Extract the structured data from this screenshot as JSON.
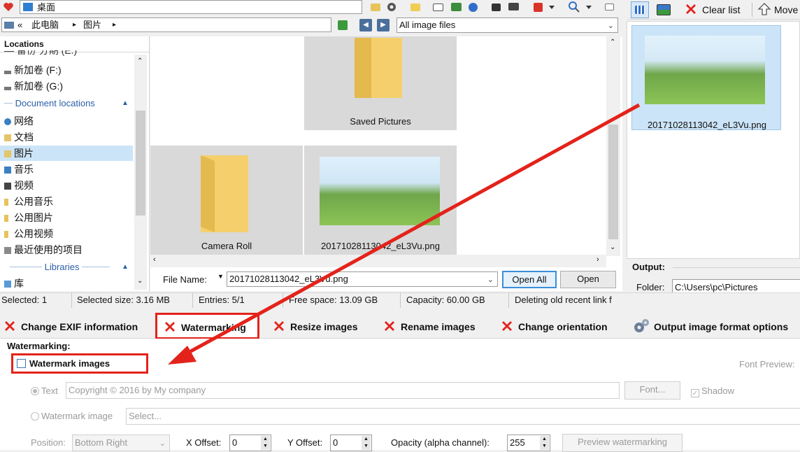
{
  "top_bar": {
    "location": "桌面"
  },
  "address": {
    "arrow": "«",
    "crumbs": [
      "此电脑",
      "图片"
    ],
    "filter": "All image files"
  },
  "right_toolbar": {
    "clear_list": "Clear list",
    "move": "Move"
  },
  "sidebar": {
    "header": "Locations",
    "items": [
      {
        "label": "新加卷 (F:)"
      },
      {
        "label": "新加卷 (G:)"
      },
      {
        "label": "Document locations"
      },
      {
        "label": "网络"
      },
      {
        "label": "文档"
      },
      {
        "label": "图片"
      },
      {
        "label": "音乐"
      },
      {
        "label": "视频"
      },
      {
        "label": "公用音乐"
      },
      {
        "label": "公用图片"
      },
      {
        "label": "公用视频"
      },
      {
        "label": "最近使用的项目"
      },
      {
        "label": "Libraries"
      },
      {
        "label": "库"
      }
    ]
  },
  "files": [
    {
      "name": "Saved Pictures"
    },
    {
      "name": "Camera Roll"
    },
    {
      "name": "20171028113042_eL3Vu.png"
    }
  ],
  "preview": {
    "name": "20171028113042_eL3Vu.png"
  },
  "filename_bar": {
    "label": "File Name:",
    "value": "20171028113042_eL3Vu.png",
    "open_all": "Open All",
    "open": "Open"
  },
  "output": {
    "title": "Output:",
    "folder_label": "Folder:",
    "folder_value": "C:\\Users\\pc\\Pictures"
  },
  "statusbar": {
    "selected": "Selected: 1",
    "size": "Selected size: 3.16 MB",
    "entries": "Entries: 5/1",
    "free": "Free space: 13.09 GB",
    "capacity": "Capacity: 60.00 GB",
    "deleting": "Deleting old recent link f"
  },
  "tabs": {
    "exif": "Change EXIF information",
    "watermarking": "Watermarking",
    "resize": "Resize images",
    "rename": "Rename images",
    "orientation": "Change orientation",
    "output_format": "Output image format options"
  },
  "watermark": {
    "section": "Watermarking:",
    "checkbox": "Watermark images",
    "font_preview": "Font Preview:",
    "text_label": "Text",
    "text_value": "Copyright © 2016 by My company",
    "font_button": "Font...",
    "shadow": "Shadow",
    "image_label": "Watermark image",
    "image_value": "Select...",
    "position_label": "Position:",
    "position_value": "Bottom Right",
    "x_label": "X Offset:",
    "x_value": "0",
    "y_label": "Y Offset:",
    "y_value": "0",
    "opacity_label": "Opacity (alpha channel):",
    "opacity_value": "255",
    "preview_button": "Preview watermarking"
  },
  "colors": {
    "highlight_red": "#e3231b",
    "selection_blue": "#cce4f7",
    "folder_yellow": "#f7d774"
  }
}
